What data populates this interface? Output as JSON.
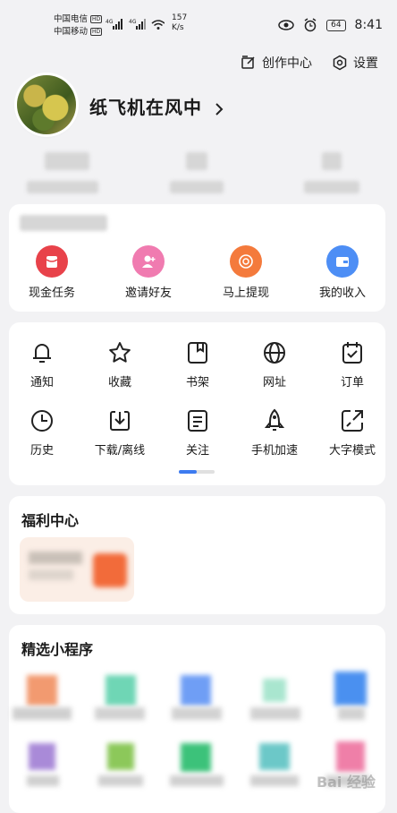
{
  "status_bar": {
    "carrier1": "中国电信",
    "carrier2": "中国移动",
    "hd": "HD",
    "net1": "4G",
    "net2": "4G",
    "speed": "157",
    "speed_unit": "K/s",
    "battery": "64",
    "time": "8:41"
  },
  "header": {
    "creator_center": "创作中心",
    "settings": "设置",
    "username": "纸飞机在风中"
  },
  "earnings": {
    "items": [
      {
        "label": "现金任务",
        "color": "#e8424a",
        "icon": "red-envelope-icon"
      },
      {
        "label": "邀请好友",
        "color": "#f07bb0",
        "icon": "invite-user-icon"
      },
      {
        "label": "马上提现",
        "color": "#f47a3c",
        "icon": "withdraw-coin-icon"
      },
      {
        "label": "我的收入",
        "color": "#4d8ef5",
        "icon": "wallet-icon"
      }
    ]
  },
  "tools": {
    "row1": [
      {
        "label": "通知",
        "icon": "bell-icon"
      },
      {
        "label": "收藏",
        "icon": "star-icon"
      },
      {
        "label": "书架",
        "icon": "bookshelf-icon"
      },
      {
        "label": "网址",
        "icon": "globe-icon"
      },
      {
        "label": "订单",
        "icon": "order-icon"
      }
    ],
    "row2": [
      {
        "label": "历史",
        "icon": "clock-icon"
      },
      {
        "label": "下载/离线",
        "icon": "download-icon"
      },
      {
        "label": "关注",
        "icon": "follow-doc-icon"
      },
      {
        "label": "手机加速",
        "icon": "rocket-icon"
      },
      {
        "label": "大字模式",
        "icon": "large-text-icon"
      }
    ]
  },
  "welfare": {
    "title": "福利中心"
  },
  "mini_programs": {
    "title": "精选小程序"
  },
  "watermark": "Bai 经验"
}
